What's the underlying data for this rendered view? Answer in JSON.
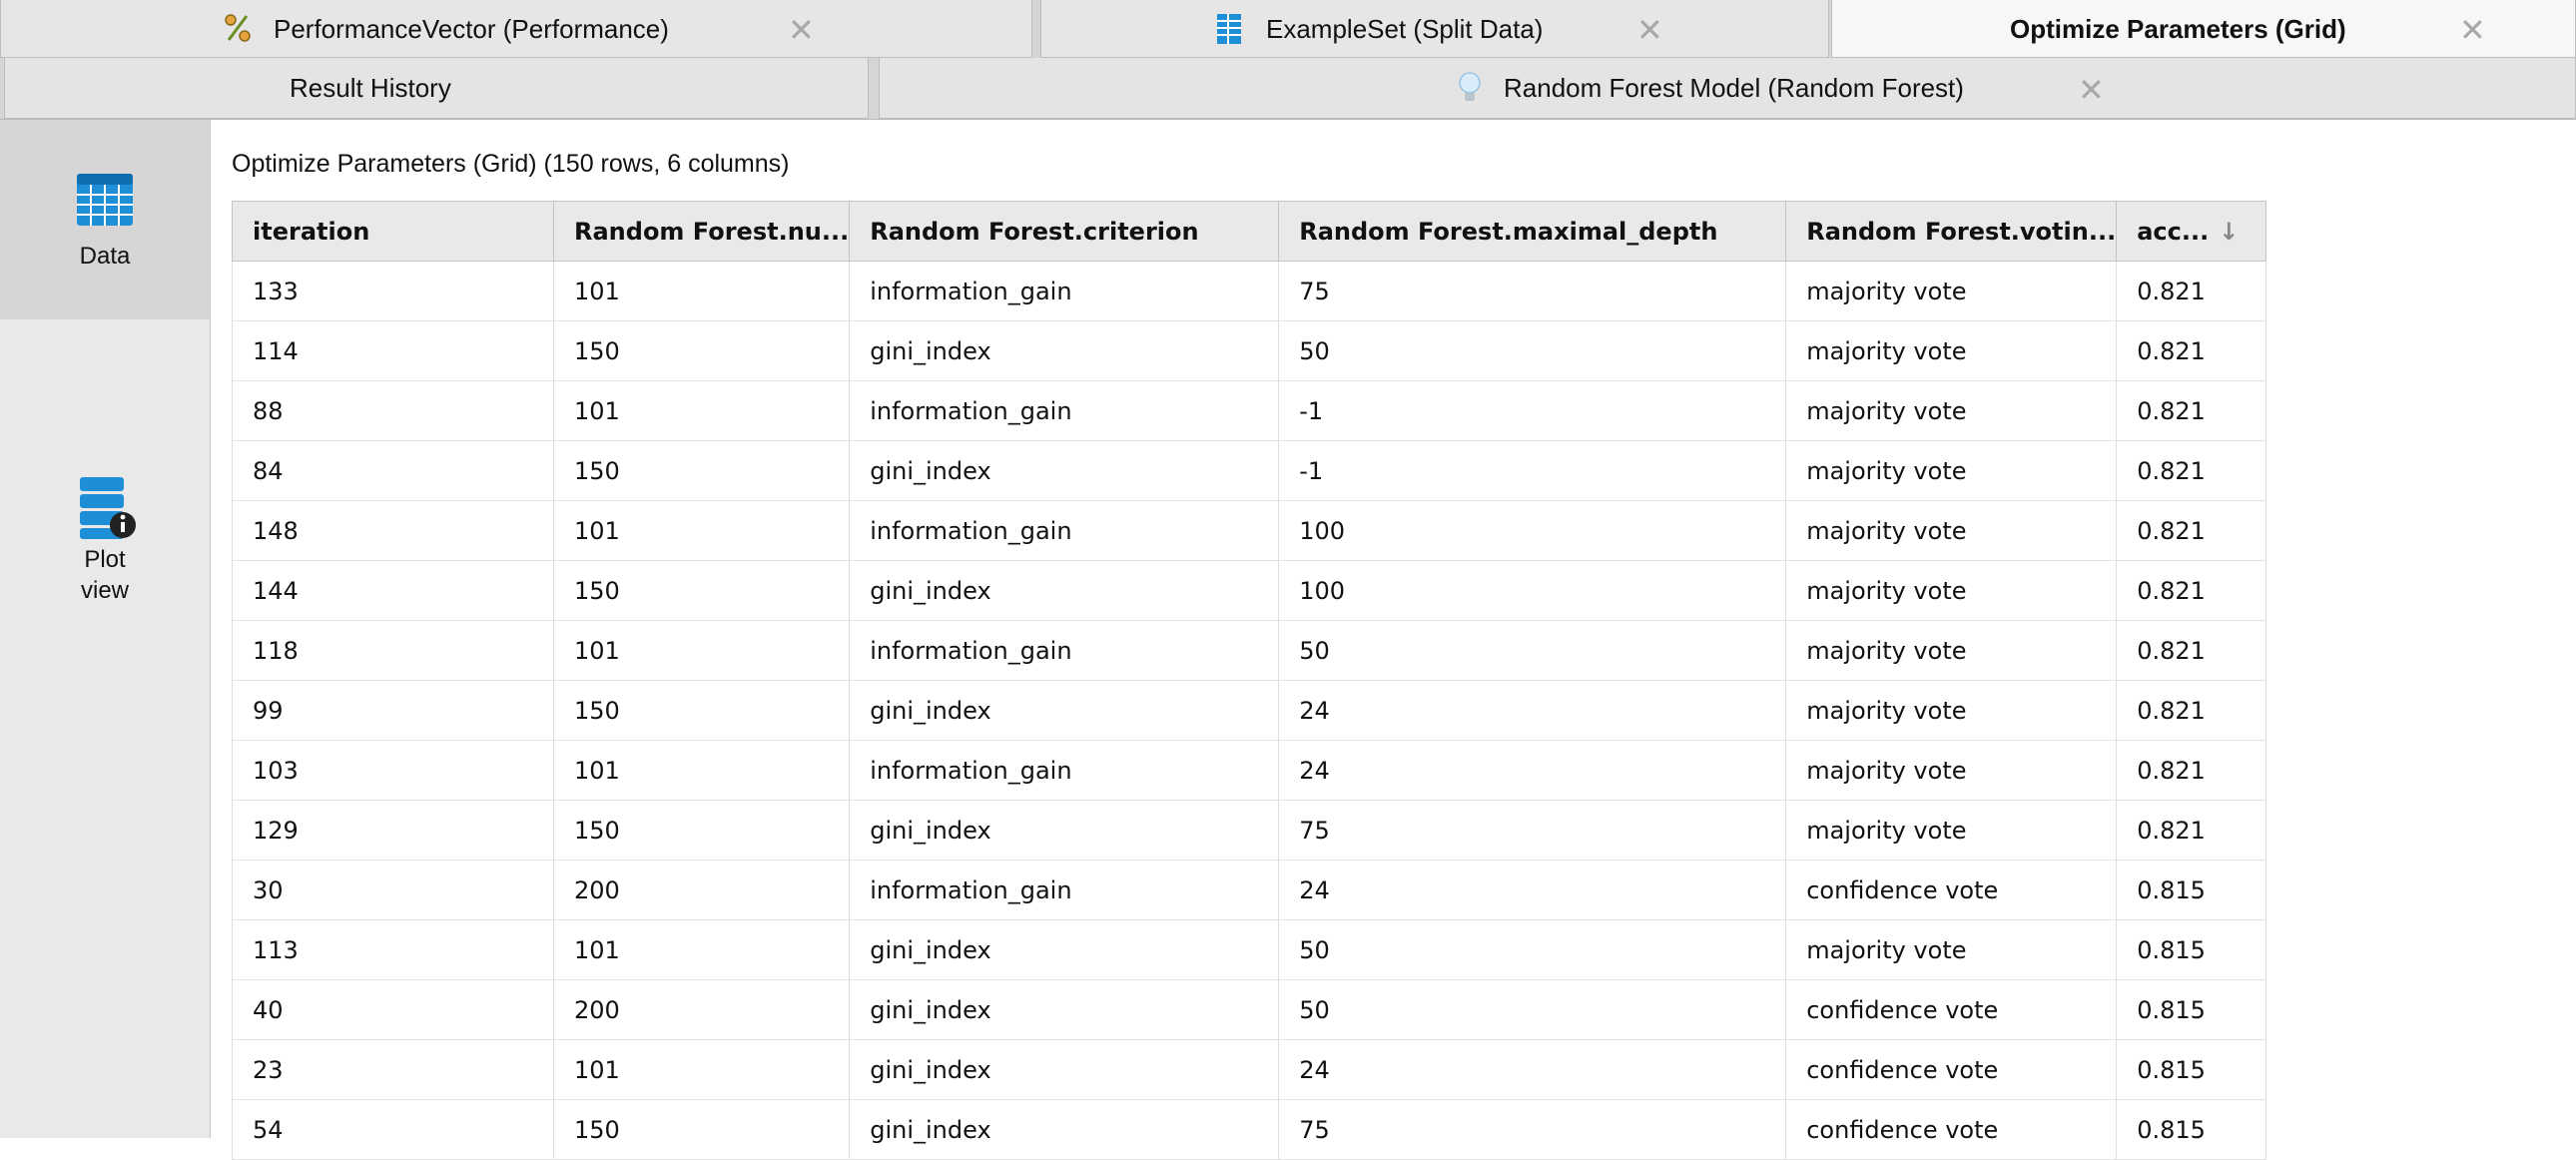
{
  "tabs_top": [
    {
      "label": "PerformanceVector (Performance)",
      "icon": "percent-icon"
    },
    {
      "label": "ExampleSet (Split Data)",
      "icon": "table-icon"
    },
    {
      "label": "Optimize Parameters (Grid)",
      "active": true
    }
  ],
  "tabs_second": [
    {
      "label": "Result History"
    },
    {
      "label": "Random Forest Model (Random Forest)",
      "icon": "lightbulb-icon"
    }
  ],
  "close_glyph": "✕",
  "sidebar": {
    "data_label": "Data",
    "plot_label_line1": "Plot",
    "plot_label_line2": "view"
  },
  "main": {
    "caption": "Optimize Parameters (Grid) (150 rows, 6 columns)",
    "columns": [
      "iteration",
      "Random Forest.nu...",
      "Random Forest.criterion",
      "Random Forest.maximal_depth",
      "Random Forest.votin...",
      "acc..."
    ],
    "sort_icon": "↓",
    "rows": [
      [
        "133",
        "101",
        "information_gain",
        "75",
        "majority vote",
        "0.821"
      ],
      [
        "114",
        "150",
        "gini_index",
        "50",
        "majority vote",
        "0.821"
      ],
      [
        "88",
        "101",
        "information_gain",
        "-1",
        "majority vote",
        "0.821"
      ],
      [
        "84",
        "150",
        "gini_index",
        "-1",
        "majority vote",
        "0.821"
      ],
      [
        "148",
        "101",
        "information_gain",
        "100",
        "majority vote",
        "0.821"
      ],
      [
        "144",
        "150",
        "gini_index",
        "100",
        "majority vote",
        "0.821"
      ],
      [
        "118",
        "101",
        "information_gain",
        "50",
        "majority vote",
        "0.821"
      ],
      [
        "99",
        "150",
        "gini_index",
        "24",
        "majority vote",
        "0.821"
      ],
      [
        "103",
        "101",
        "information_gain",
        "24",
        "majority vote",
        "0.821"
      ],
      [
        "129",
        "150",
        "gini_index",
        "75",
        "majority vote",
        "0.821"
      ],
      [
        "30",
        "200",
        "information_gain",
        "24",
        "confidence vote",
        "0.815"
      ],
      [
        "113",
        "101",
        "gini_index",
        "50",
        "majority vote",
        "0.815"
      ],
      [
        "40",
        "200",
        "gini_index",
        "50",
        "confidence vote",
        "0.815"
      ],
      [
        "23",
        "101",
        "gini_index",
        "24",
        "confidence vote",
        "0.815"
      ],
      [
        "54",
        "150",
        "gini_index",
        "75",
        "confidence vote",
        "0.815"
      ]
    ]
  },
  "colors": {
    "icon_blue": "#1e8fd6",
    "accent_orange": "#e6a23c"
  }
}
